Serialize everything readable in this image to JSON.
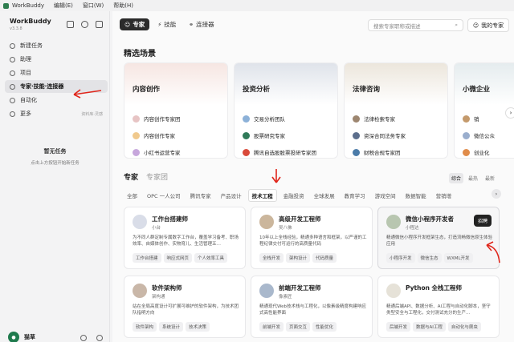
{
  "menubar": {
    "app": "WorkBuddy",
    "items": [
      "编辑(E)",
      "窗口(W)",
      "帮助(H)"
    ]
  },
  "sidebar": {
    "app_name": "WorkBuddy",
    "version": "v3.3.8",
    "nav": [
      {
        "label": "新建任务",
        "icon": "plus-icon"
      },
      {
        "label": "助理",
        "icon": "chat-icon"
      },
      {
        "label": "项目",
        "icon": "folder-icon"
      },
      {
        "label": "专家·技能·连接器",
        "icon": "expert-icon"
      },
      {
        "label": "自动化",
        "icon": "clock-icon"
      },
      {
        "label": "更多",
        "icon": "more-icon",
        "extra": "资料库·灵感"
      }
    ],
    "empty_title": "暂无任务",
    "empty_sub": "点击上方按钮开始新任务",
    "user_name": "猫草"
  },
  "tabs": [
    {
      "label": "专家",
      "icon": "expert-icon"
    },
    {
      "label": "技能",
      "icon": "bolt-icon"
    },
    {
      "label": "连接器",
      "icon": "link-icon"
    }
  ],
  "search": {
    "placeholder": "搜索专家职称或描述"
  },
  "my_expert": "我的专家",
  "featured_title": "精选场景",
  "scenes": [
    {
      "title": "内容创作",
      "items": [
        "内容创作专家团",
        "内容创作专家",
        "小红书运营专家"
      ],
      "colors": [
        "#e7c4c4",
        "#f0c98d",
        "#c7a7dc"
      ],
      "bg": "#f6e6e2"
    },
    {
      "title": "投资分析",
      "items": [
        "交易分析团队",
        "股票研究专家",
        "腾讯自选股股票投研专家团"
      ],
      "colors": [
        "#8cb1d8",
        "#2f7a59",
        "#d94a3a"
      ],
      "bg": "#dfe3ea"
    },
    {
      "title": "法律咨询",
      "items": [
        "法律检索专家",
        "资深合同法务专家",
        "财税合规专家团"
      ],
      "colors": [
        "#9d8670",
        "#5c6e8c",
        "#4b7ba8"
      ],
      "bg": "#ece6dc"
    },
    {
      "title": "小微企业",
      "items": [
        "销",
        "微信公众",
        "创业化"
      ],
      "colors": [
        "#c49a6c",
        "#9aaecd",
        "#e08c4a"
      ],
      "bg": "#e5ecee"
    }
  ],
  "sub_tabs": [
    "专家",
    "专家团"
  ],
  "sort": [
    "综合",
    "最热",
    "最新"
  ],
  "categories": [
    "全部",
    "OPC 一人公司",
    "腾讯专家",
    "产品设计",
    "技术工程",
    "金融投资",
    "全球发展",
    "教育学习",
    "游戏空间",
    "数据智能",
    "营销增"
  ],
  "cards": [
    {
      "name": "工作台搭建师",
      "author": "小台",
      "desc": "为不同人群定制专属数字工作台，覆盖学习备考、职场效率、自媒体创作、实物育儿、生活管理五…",
      "tags": [
        "工作台搭建",
        "响应式网页",
        "个人效率工具"
      ],
      "avatar": "#d9dde8"
    },
    {
      "name": "高级开发工程师",
      "author": "吴八佛",
      "desc": "10年以上全栈经验，精通多种语言和框架，以严谨的工程纪律交付可运行的高质量代码",
      "tags": [
        "全栈开发",
        "架构设计",
        "代码质量"
      ],
      "avatar": "#cbb69c"
    },
    {
      "name": "微信小程序开发者",
      "author": "小程达",
      "desc": "精通微信小程序开发框架生态，打造流畅微信原生体验应用",
      "tags": [
        "小程序开发",
        "微信生态",
        "WXML开发"
      ],
      "avatar": "#b8c6b0",
      "hire": "招聘"
    },
    {
      "name": "软件架构师",
      "author": "架构通",
      "desc": "站在全局高度设计可扩展可维护的软件架构，为技术团队指明方向",
      "tags": [
        "软件架构",
        "系统设计",
        "技术决策"
      ],
      "avatar": "#c9b7a8"
    },
    {
      "name": "前端开发工程师",
      "author": "像素匠",
      "desc": "精通现代Web技术栈与工程化，以像素级精度构建响应式高性能界面",
      "tags": [
        "前端开发",
        "页面交互",
        "性能优化"
      ],
      "avatar": "#a9b8cc"
    },
    {
      "name": "Python 全栈工程师",
      "author": "",
      "desc": "精通后端API、数据分析、AI工程与自动化脚本，坚守类型安全与工程化，交付测试充分的生产…",
      "tags": [
        "后端开发",
        "数据与AI工程",
        "自动化与爬虫"
      ],
      "avatar": "#e6e2d8"
    }
  ]
}
